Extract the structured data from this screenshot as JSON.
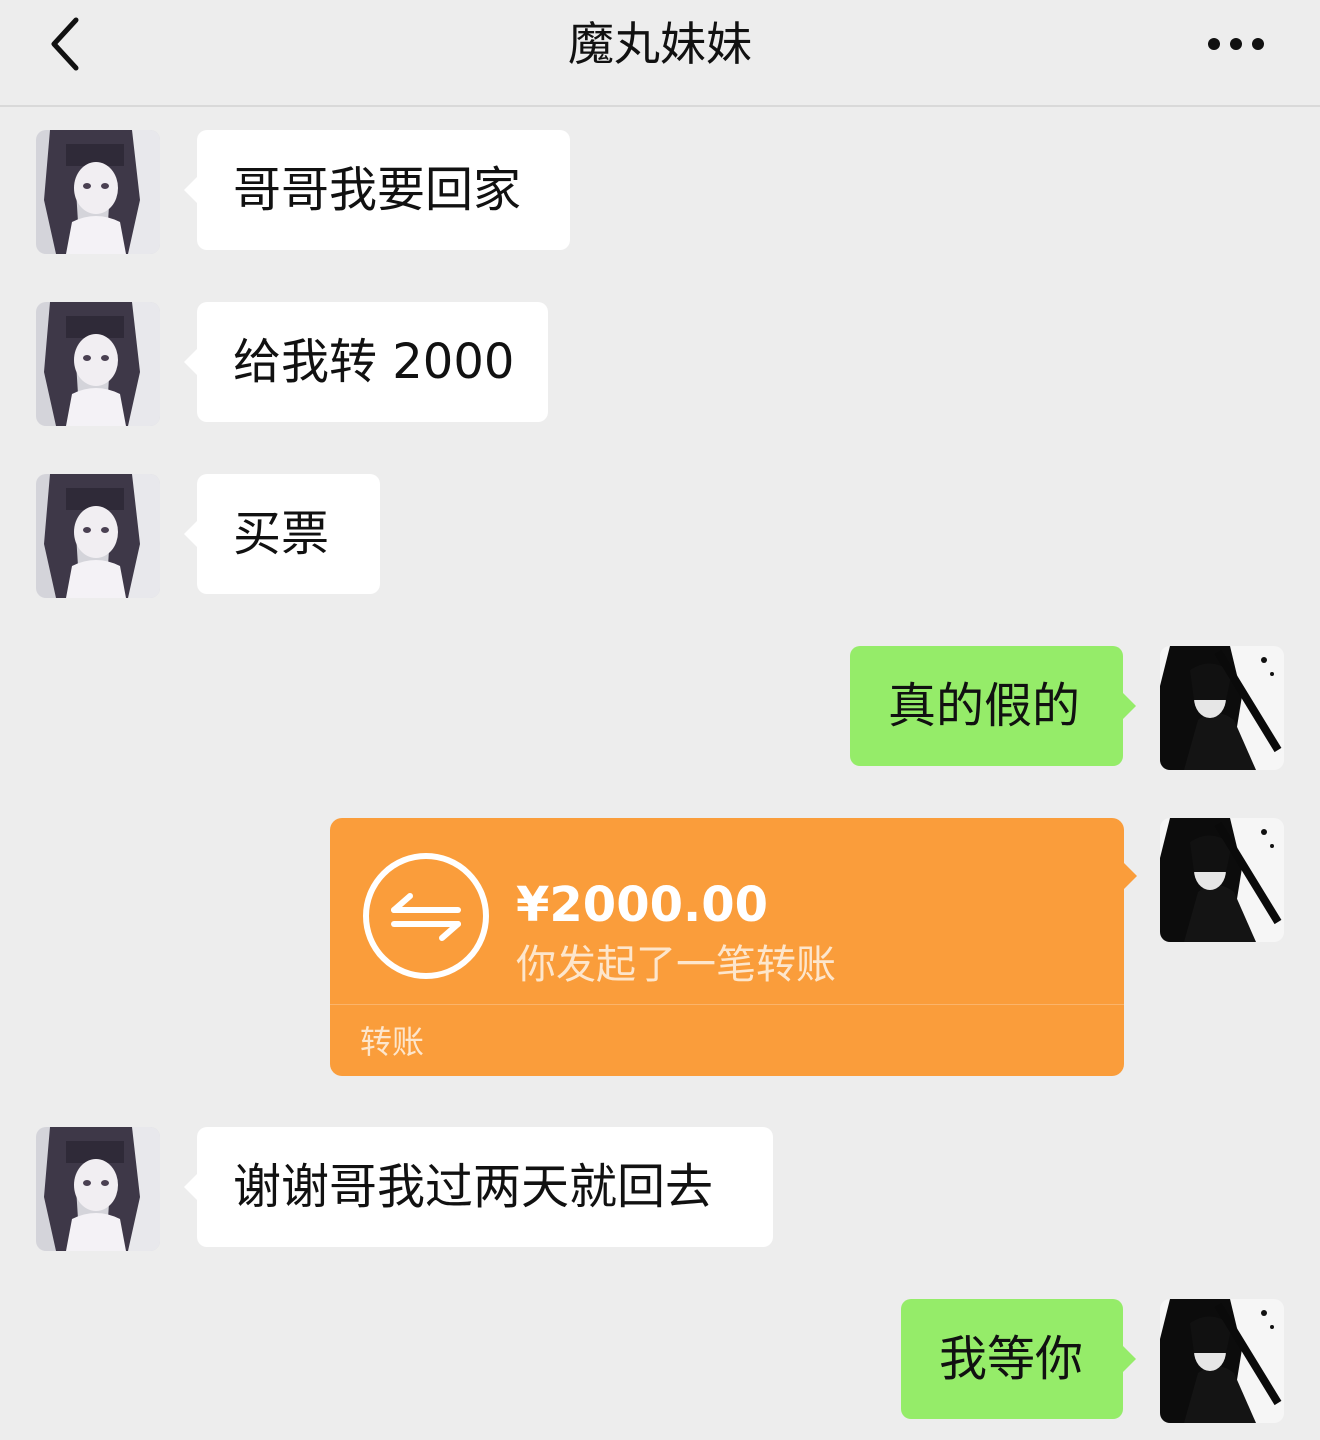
{
  "header": {
    "title": "魔丸妹妹",
    "back_icon": "chevron-left-icon",
    "more_icon": "more-dots-icon"
  },
  "messages": [
    {
      "from": "contact",
      "text": "哥哥我要回家"
    },
    {
      "from": "contact",
      "text": "给我转 2000"
    },
    {
      "from": "contact",
      "text": "买票"
    },
    {
      "from": "self",
      "text": "真的假的"
    },
    {
      "from": "self",
      "type": "transfer",
      "amount": "¥2000.00",
      "description": "你发起了一笔转账",
      "footer": "转账"
    },
    {
      "from": "contact",
      "text": "谢谢哥我过两天就回去"
    },
    {
      "from": "self",
      "text": "我等你"
    }
  ],
  "colors": {
    "background": "#ededed",
    "incoming_bubble": "#ffffff",
    "outgoing_bubble": "#95ec69",
    "transfer_card": "#fa9d3b"
  }
}
